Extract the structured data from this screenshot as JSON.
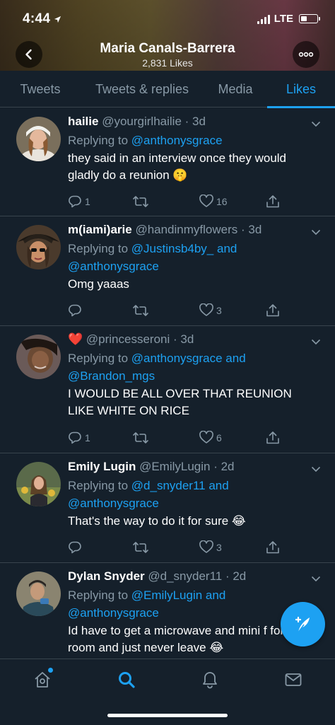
{
  "status_bar": {
    "time": "4:44",
    "carrier": "LTE"
  },
  "header": {
    "name": "Maria Canals-Barrera",
    "subtitle": "2,831 Likes"
  },
  "tabs": [
    {
      "label": "Tweets",
      "active": false
    },
    {
      "label": "Tweets & replies",
      "active": false
    },
    {
      "label": "Media",
      "active": false
    },
    {
      "label": "Likes",
      "active": true
    }
  ],
  "tweets": [
    {
      "name": "hailie",
      "handle": "@yourgirlhailie",
      "time": "3d",
      "reply_prefix": "Replying to ",
      "reply_line1": "@anthonysgrace",
      "reply_line2": "",
      "text": "they said in an interview once they would gladly do a reunion 🤫",
      "replies": "1",
      "retweets": "",
      "likes": "16"
    },
    {
      "name": "m(iami)arie",
      "handle": "@handinmyflowers",
      "time": "3d",
      "reply_prefix": "Replying to ",
      "reply_line1": "@Justinsb4by_ and",
      "reply_line2": "@anthonysgrace",
      "text": "Omg yaaas",
      "replies": "",
      "retweets": "",
      "likes": "3"
    },
    {
      "name": "❤️",
      "handle": "@princesseroni",
      "time": "3d",
      "reply_prefix": "Replying to ",
      "reply_line1": "@anthonysgrace and",
      "reply_line2": "@Brandon_mgs",
      "text": "I WOULD BE ALL OVER THAT REUNION LIKE WHITE ON RICE",
      "replies": "1",
      "retweets": "",
      "likes": "6"
    },
    {
      "name": "Emily Lugin",
      "handle": "@EmilyLugin",
      "time": "2d",
      "reply_prefix": "Replying to ",
      "reply_line1": "@d_snyder11 and",
      "reply_line2": "@anthonysgrace",
      "text": "That's the way to do it for sure 😂",
      "replies": "",
      "retweets": "",
      "likes": "3"
    },
    {
      "name": "Dylan Snyder",
      "handle": "@d_snyder11",
      "time": "2d",
      "reply_prefix": "Replying to ",
      "reply_line1": "@EmilyLugin and",
      "reply_line2": "@anthonysgrace",
      "text": "Id have to get a microwave and mini f for my room and just never leave 😂",
      "replies": "",
      "retweets": "",
      "likes": ""
    }
  ],
  "colors": {
    "accent": "#1da1f2",
    "background": "#15202b",
    "muted": "#8899a6",
    "divider": "#38444d"
  },
  "icons": {
    "back": "chevron-left-icon",
    "more": "more-horizontal-icon",
    "compose": "compose-tweet-icon",
    "home": "home-icon",
    "search": "search-icon",
    "notifications": "bell-icon",
    "messages": "mail-icon"
  }
}
